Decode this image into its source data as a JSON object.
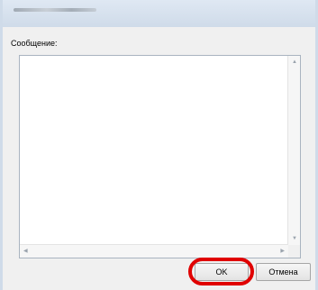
{
  "dialog": {
    "message_label": "Сообщение:",
    "message_value": "",
    "ok_label": "OK",
    "cancel_label": "Отмена"
  },
  "icons": {
    "scroll_up": "scroll-up-arrow",
    "scroll_down": "scroll-down-arrow",
    "scroll_left": "scroll-left-arrow",
    "scroll_right": "scroll-right-arrow"
  },
  "colors": {
    "highlight": "#e00000",
    "titlebar": "#cfdbe9",
    "window_bg": "#f0f0f0"
  }
}
